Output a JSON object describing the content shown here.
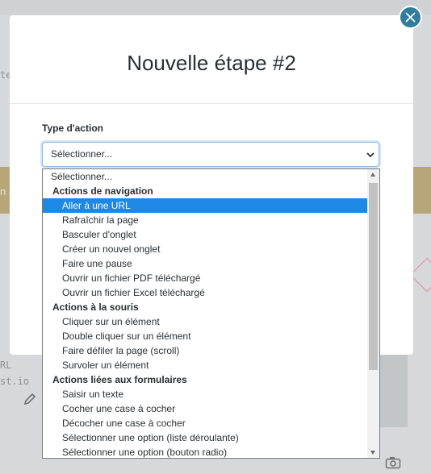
{
  "modal": {
    "title": "Nouvelle étape #2",
    "field_label": "Type d'action",
    "select_value": "Sélectionner..."
  },
  "dropdown": {
    "rows": [
      {
        "kind": "plain",
        "label": "Sélectionner..."
      },
      {
        "kind": "group",
        "label": "Actions de navigation"
      },
      {
        "kind": "option",
        "label": "Aller à une URL",
        "selected": true
      },
      {
        "kind": "option",
        "label": "Rafraîchir la page"
      },
      {
        "kind": "option",
        "label": "Basculer d'onglet"
      },
      {
        "kind": "option",
        "label": "Créer un nouvel onglet"
      },
      {
        "kind": "option",
        "label": "Faire une pause"
      },
      {
        "kind": "option",
        "label": "Ouvrir un fichier PDF téléchargé"
      },
      {
        "kind": "option",
        "label": "Ouvrir un fichier Excel téléchargé"
      },
      {
        "kind": "group",
        "label": "Actions à la souris"
      },
      {
        "kind": "option",
        "label": "Cliquer sur un élément"
      },
      {
        "kind": "option",
        "label": "Double cliquer sur un élément"
      },
      {
        "kind": "option",
        "label": "Faire défiler la page (scroll)"
      },
      {
        "kind": "option",
        "label": "Survoler un élément"
      },
      {
        "kind": "group",
        "label": "Actions liées aux formulaires"
      },
      {
        "kind": "option",
        "label": "Saisir un texte"
      },
      {
        "kind": "option",
        "label": "Cocher une case à cocher"
      },
      {
        "kind": "option",
        "label": "Décocher une case à cocher"
      },
      {
        "kind": "option",
        "label": "Sélectionner une option (liste déroulante)"
      },
      {
        "kind": "option",
        "label": "Sélectionner une option (bouton radio)"
      }
    ]
  },
  "background": {
    "band_text": "n -",
    "side_texts": [
      "te",
      "RL",
      "st.io"
    ]
  },
  "colors": {
    "accent": "#1e88e5",
    "close_button": "#2f7e9c",
    "band": "#b7a67a"
  },
  "icons": {
    "close": "close-icon",
    "chevron": "chevron-down-icon",
    "pencil": "pencil-icon",
    "camera": "camera-icon"
  }
}
